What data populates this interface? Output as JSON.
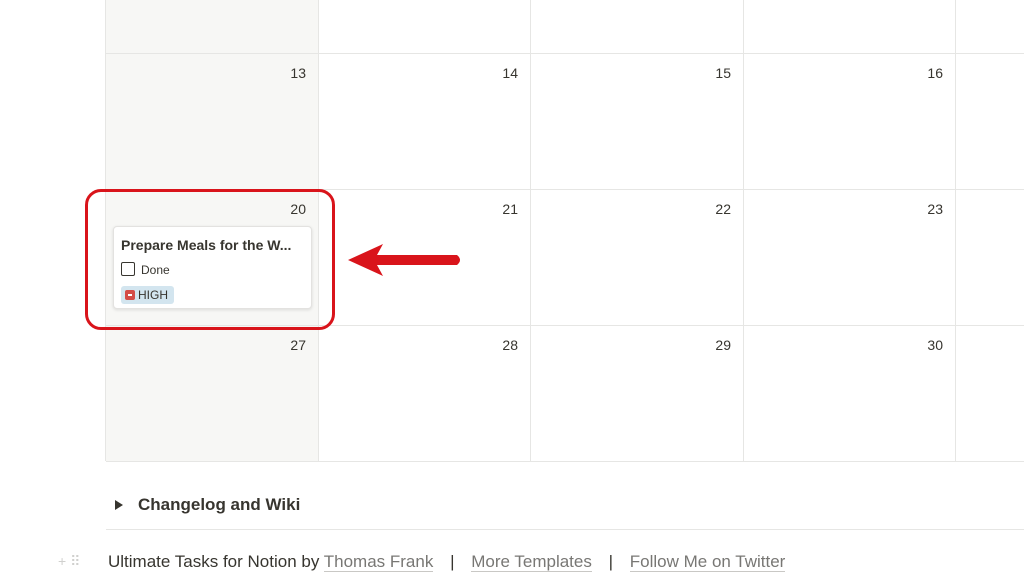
{
  "calendar": {
    "weeks": [
      {
        "days": [
          "",
          "",
          "",
          "",
          ""
        ]
      },
      {
        "days": [
          "13",
          "14",
          "15",
          "16",
          ""
        ]
      },
      {
        "days": [
          "20",
          "21",
          "22",
          "23",
          ""
        ]
      },
      {
        "days": [
          "27",
          "28",
          "29",
          "30",
          ""
        ]
      }
    ]
  },
  "task_card": {
    "title": "Prepare Meals for the W...",
    "checkbox_label": "Done",
    "checkbox_checked": false,
    "priority_tag": "HIGH",
    "priority_color": "#d3e5ef",
    "priority_icon": "alarm-icon"
  },
  "annotation": {
    "highlight_color": "#d9141b",
    "arrow": "left-arrow"
  },
  "toggle": {
    "label": "Changelog and Wiki"
  },
  "footer": {
    "prefix": "Ultimate Tasks for Notion by",
    "author_link": "Thomas Frank",
    "separator": "|",
    "templates_link": "More Templates",
    "twitter_link": "Follow Me on Twitter"
  }
}
